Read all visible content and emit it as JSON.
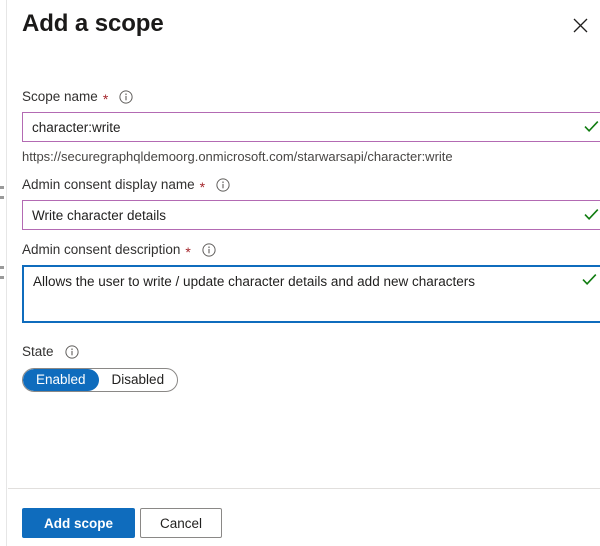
{
  "dialog": {
    "title": "Add a scope",
    "close_icon": "close-icon"
  },
  "fields": {
    "scope_name": {
      "label": "Scope name",
      "required_marker": "*",
      "info_icon": "info-icon",
      "value": "character:write",
      "validation_icon": "checkmark-icon",
      "helper_url": "https://securegraphqldemoorg.onmicrosoft.com/starwarsapi/character:write"
    },
    "admin_consent_display_name": {
      "label": "Admin consent display name",
      "required_marker": "*",
      "info_icon": "info-icon",
      "value": "Write character details",
      "validation_icon": "checkmark-icon"
    },
    "admin_consent_description": {
      "label": "Admin consent description",
      "required_marker": "*",
      "info_icon": "info-icon",
      "value": "Allows the user to write / update character details and add new characters",
      "validation_icon": "checkmark-icon"
    },
    "state": {
      "label": "State",
      "info_icon": "info-icon",
      "options": [
        "Enabled",
        "Disabled"
      ],
      "selected": "Enabled"
    }
  },
  "footer": {
    "primary_label": "Add scope",
    "secondary_label": "Cancel"
  },
  "colors": {
    "accent_blue": "#0f6cbd",
    "input_border_purple": "#b36ab3",
    "validation_green": "#107c10",
    "required_red": "#a4262c",
    "divider": "#e1dfdd"
  }
}
